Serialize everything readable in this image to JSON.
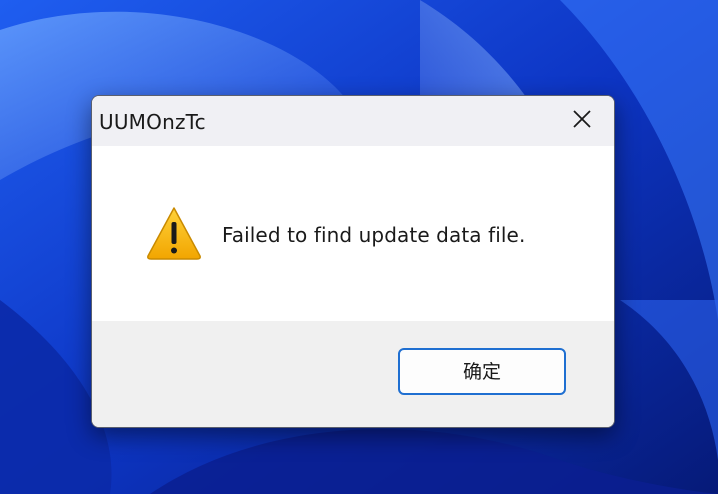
{
  "dialog": {
    "title": "UUMOnzTc",
    "message": "Failed to find update data file.",
    "icon": "warning-icon",
    "close_icon": "close-icon",
    "ok_label": "确定",
    "accent_color": "#1f6fd1",
    "warning_color": "#f7b500"
  }
}
